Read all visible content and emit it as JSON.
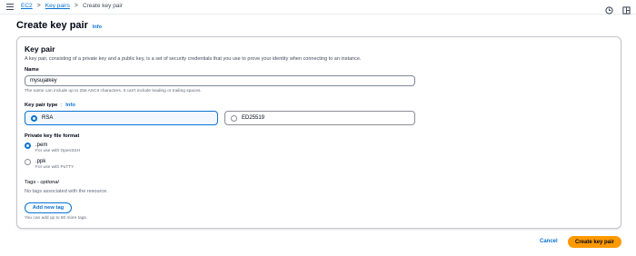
{
  "breadcrumb": {
    "items": [
      "EC2",
      "Key pairs"
    ],
    "current": "Create key pair",
    "separator": ">"
  },
  "header": {
    "title": "Create key pair",
    "info_label": "Info"
  },
  "panel": {
    "title": "Key pair",
    "description": "A key pair, consisting of a private key and a public key, is a set of security credentials that you use to prove your identity when connecting to an instance."
  },
  "name_field": {
    "label": "Name",
    "value": "mysujalkey",
    "hint": "The name can include up to 255 ASCII characters. It can't include leading or trailing spaces."
  },
  "key_type": {
    "label": "Key pair type",
    "info_label": "Info",
    "options": [
      "RSA",
      "ED25519"
    ],
    "selected": "RSA"
  },
  "file_format": {
    "label": "Private key file format",
    "options": [
      {
        "label": ".pem",
        "sub": "For use with OpenSSH"
      },
      {
        "label": ".ppk",
        "sub": "For use with PuTTY"
      }
    ],
    "selected": ".pem"
  },
  "tags": {
    "title_prefix": "Tags - ",
    "title_optional": "optional",
    "empty_text": "No tags associated with the resource.",
    "add_button": "Add new tag",
    "hint": "You can add up to 50 more tags."
  },
  "footer": {
    "cancel": "Cancel",
    "create": "Create key pair"
  },
  "colors": {
    "accent": "#0972d3",
    "primary_button": "#ff9900"
  }
}
